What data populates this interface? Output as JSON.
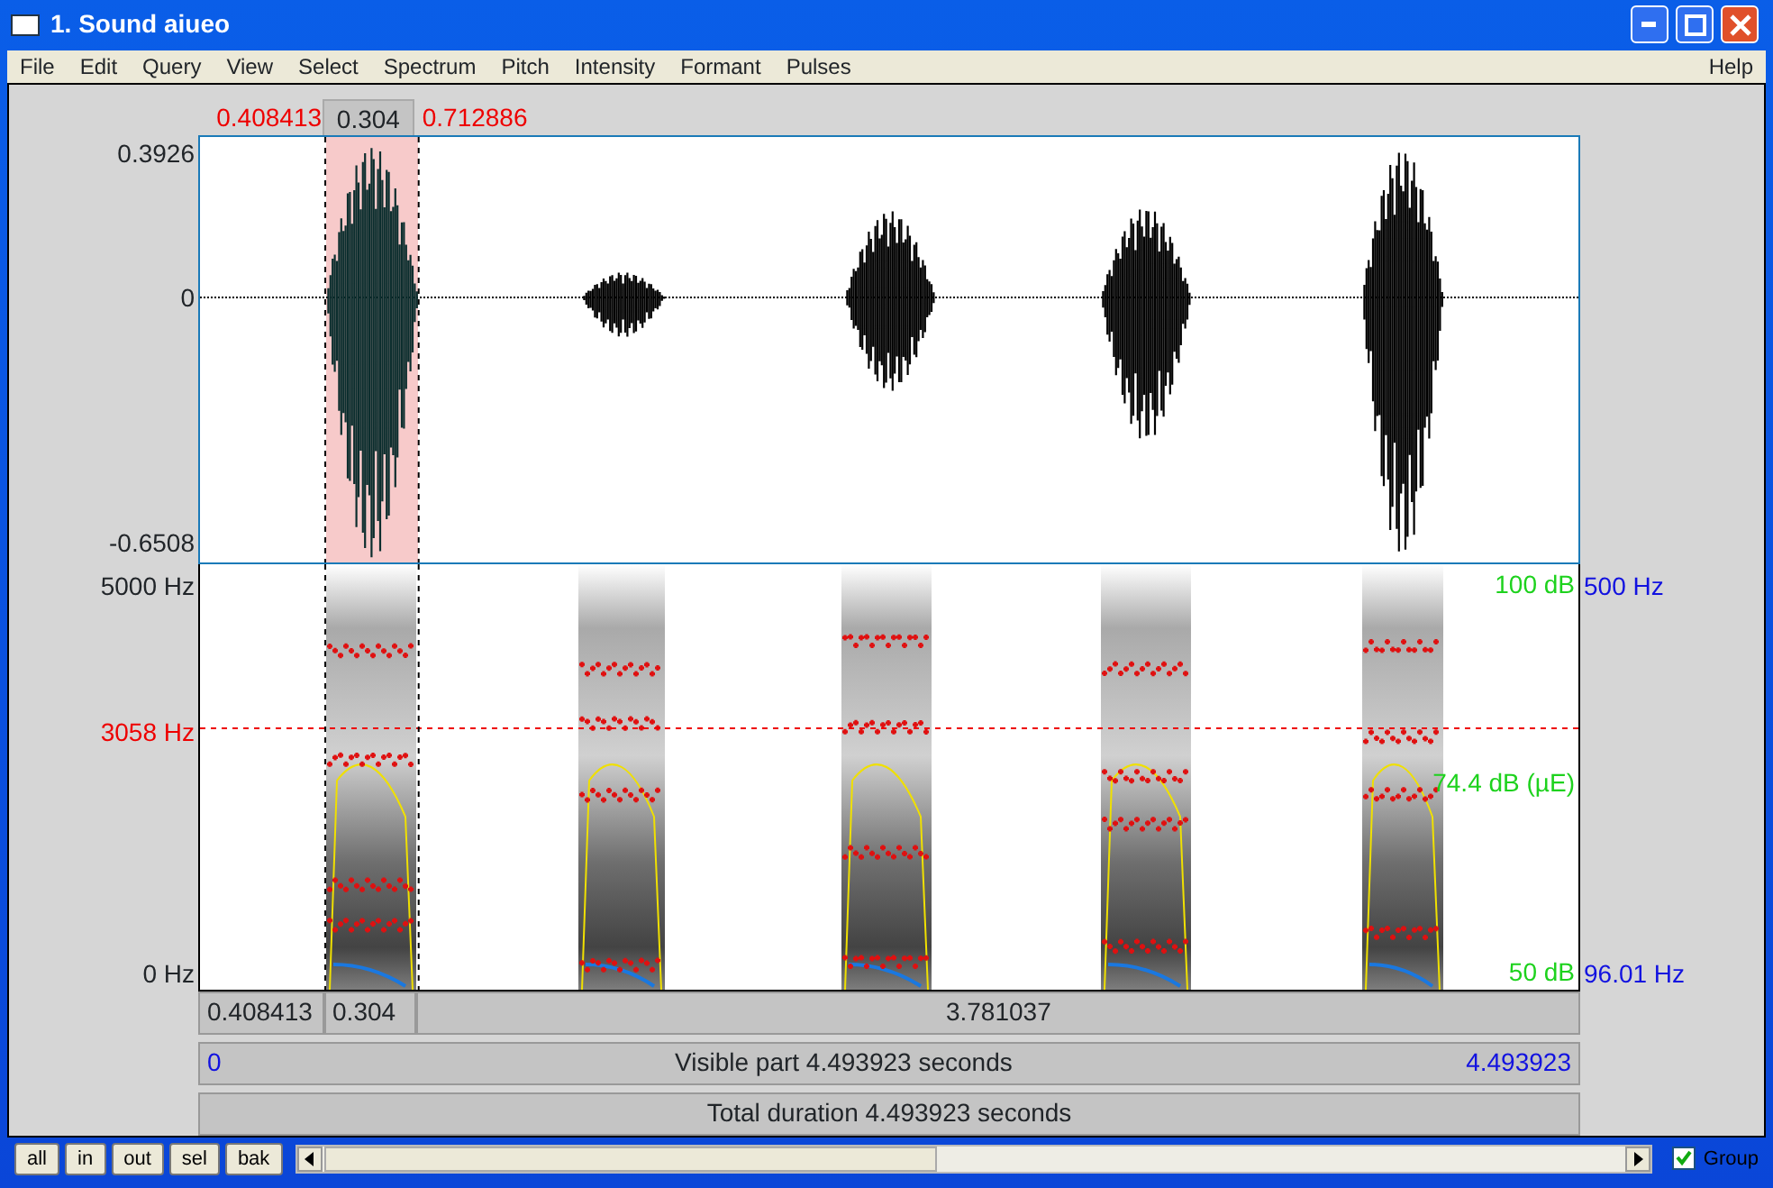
{
  "window": {
    "title": "1. Sound aiueo"
  },
  "menu": [
    "File",
    "Edit",
    "Query",
    "View",
    "Select",
    "Spectrum",
    "Pitch",
    "Intensity",
    "Formant",
    "Pulses"
  ],
  "help": "Help",
  "selection": {
    "start": "0.408413",
    "duration": "0.304",
    "end": "0.712886"
  },
  "waveform": {
    "ymax": "0.3926",
    "zero": "0",
    "ymin": "-0.6508"
  },
  "spectrogram": {
    "ymax": "5000 Hz",
    "cursor": "3058 Hz",
    "ymin": "0 Hz",
    "intensity_max": "100 dB",
    "intensity_cursor": "74.4 dB (µE)",
    "intensity_min": "50 dB",
    "pitch_max": "500 Hz",
    "pitch_min": "96.01 Hz"
  },
  "bars": {
    "before": "0.408413",
    "selection": "0.304",
    "after": "3.781037",
    "visible_start": "0",
    "visible": "Visible part 4.493923 seconds",
    "visible_end": "4.493923",
    "total": "Total duration 4.493923 seconds"
  },
  "buttons": [
    "all",
    "in",
    "out",
    "sel",
    "bak"
  ],
  "group": {
    "label": "Group",
    "checked": true
  }
}
